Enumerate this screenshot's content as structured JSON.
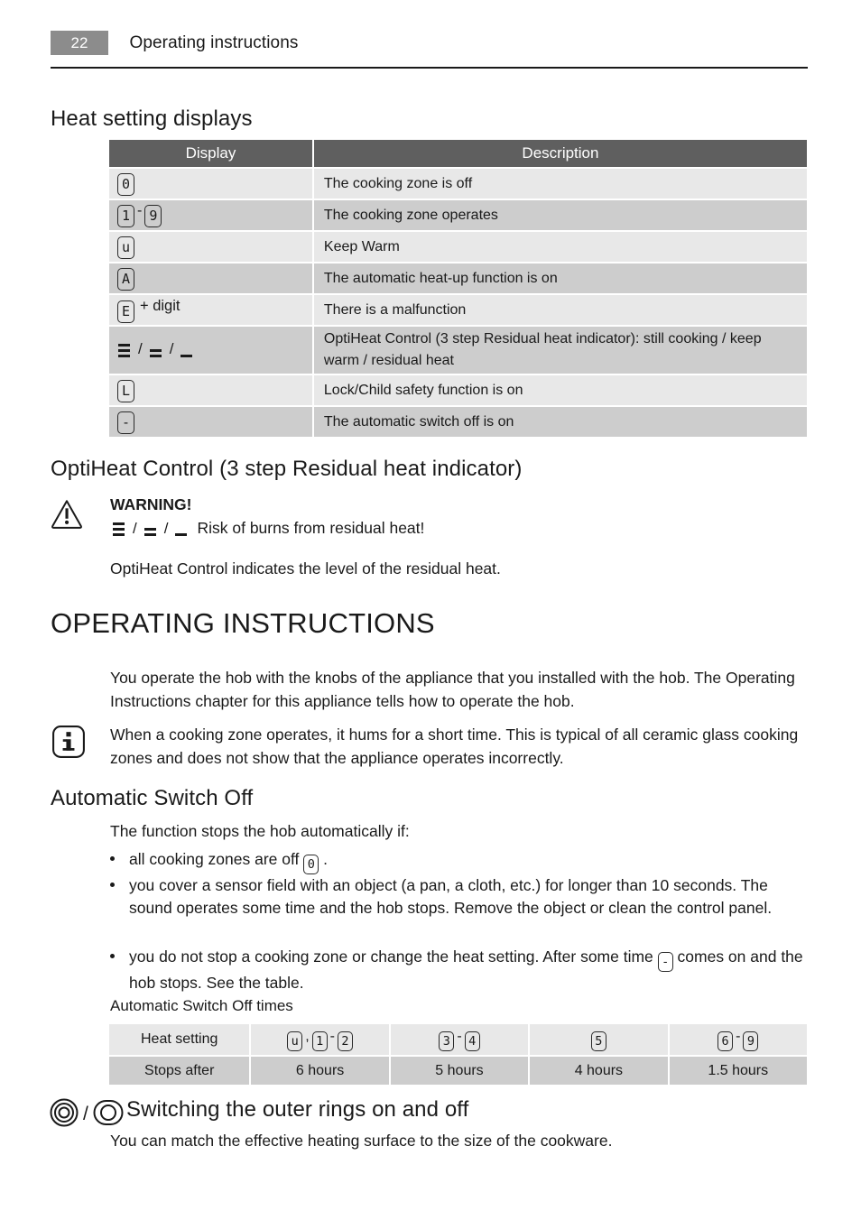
{
  "header": {
    "page_number": "22",
    "title": "Operating instructions"
  },
  "sections": {
    "heat_setting_displays": {
      "heading": "Heat setting displays",
      "table": {
        "columns": [
          "Display",
          "Description"
        ],
        "rows": [
          {
            "display_glyphs": [
              "0"
            ],
            "description": "The cooking zone is off"
          },
          {
            "display_glyphs": [
              "1",
              "-",
              "9"
            ],
            "description": "The cooking zone operates"
          },
          {
            "display_glyphs": [
              "u"
            ],
            "description": "Keep Warm"
          },
          {
            "display_glyphs": [
              "A"
            ],
            "description": "The automatic heat-up function is on"
          },
          {
            "display_glyphs": [
              "E",
              "+ digit"
            ],
            "description": "There is a malfunction"
          },
          {
            "display_glyphs": [
              "bars3",
              "/",
              "bars2",
              "/",
              "bars1"
            ],
            "description": "OptiHeat Control (3 step Residual heat indicator): still cooking / keep warm / residual heat"
          },
          {
            "display_glyphs": [
              "L"
            ],
            "description": "Lock/Child safety function is on"
          },
          {
            "display_glyphs": [
              "-"
            ],
            "description": "The automatic switch off is on"
          }
        ]
      }
    },
    "optiheat": {
      "heading": "OptiHeat Control (3 step Residual heat indicator)",
      "warning_label": "WARNING!",
      "warning_text": "Risk of burns from residual heat!",
      "body": "OptiHeat Control indicates the level of the residual heat."
    },
    "operating_instructions": {
      "heading": "OPERATING INSTRUCTIONS",
      "paragraph": "You operate the hob with the knobs of the appliance that you installed with the hob. The Operating Instructions chapter for this appliance tells how to operate the hob.",
      "note": "When a cooking zone operates, it hums for a short time. This is typical of all ceramic glass cooking zones and does not show that the appliance operates incorrectly."
    },
    "automatic_switch_off": {
      "heading": "Automatic Switch Off",
      "intro": "The function stops the hob automatically if:",
      "bullets": [
        {
          "pre": "all cooking zones are off",
          "glyph": "0",
          "post": "."
        },
        {
          "text": "you cover a sensor field with an object (a pan, a cloth, etc.) for longer than 10 seconds. The sound operates some time and the hob stops. Remove the object or clean the control panel."
        },
        {
          "pre": "you do not stop a cooking zone or change the heat setting. After some time",
          "glyph": "-",
          "post": "comes on and the hob stops. See the table."
        }
      ],
      "table_caption": "Automatic Switch Off times",
      "table": {
        "row_labels": [
          "Heat setting",
          "Stops after"
        ],
        "heat_settings": [
          [
            "u",
            ",",
            "1",
            "-",
            "2"
          ],
          [
            "3",
            "-",
            "4"
          ],
          [
            "5"
          ],
          [
            "6",
            "-",
            "9"
          ]
        ],
        "stops_after": [
          "6 hours",
          "5 hours",
          "4 hours",
          "1.5 hours"
        ]
      }
    },
    "outer_rings": {
      "heading": "Switching the outer rings on and off",
      "separator": "/",
      "body": "You can match the effective heating surface to the size of the cookware."
    }
  },
  "colors": {
    "header_badge": "#8c8c8c",
    "table_header": "#5f5f5f",
    "row_light": "#e8e8e8",
    "row_dark": "#cdcdcd",
    "text": "#1a1a1a"
  }
}
